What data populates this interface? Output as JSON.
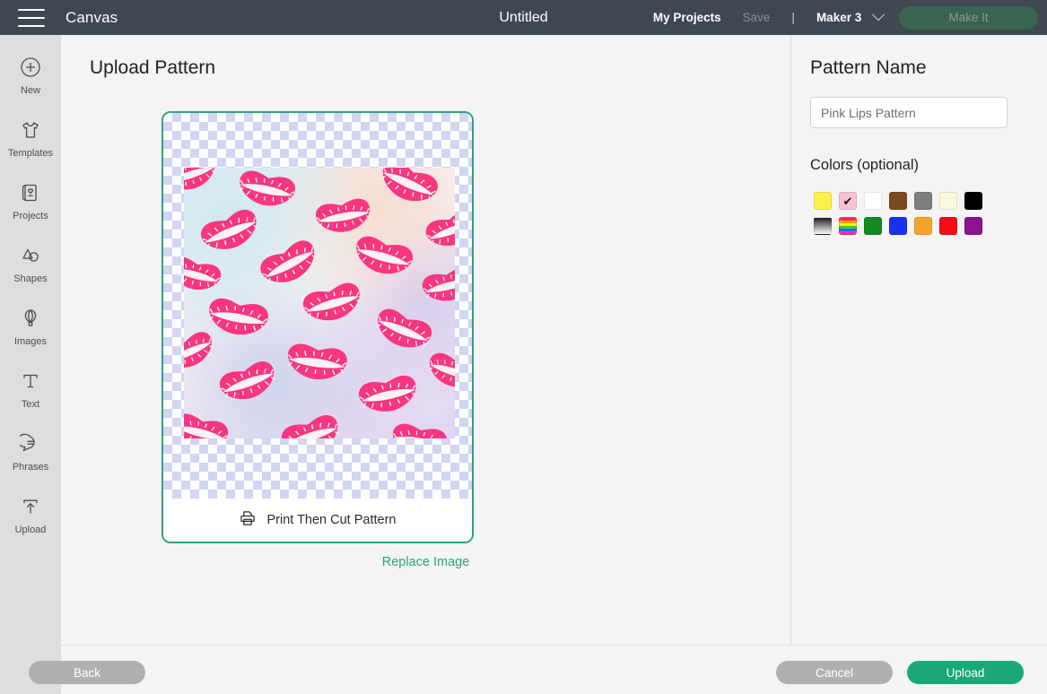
{
  "header": {
    "menu_icon": "hamburger-icon",
    "app_name": "Canvas",
    "project_title": "Untitled",
    "my_projects": "My Projects",
    "save": "Save",
    "separator": "|",
    "machine": "Maker 3",
    "machine_chevron": "chevron-down-icon",
    "make_it": "Make It",
    "bar_color": "#3f4750",
    "make_it_color": "#3a6352"
  },
  "sidebar": {
    "items": [
      {
        "label": "New",
        "icon": "plus-circle-icon"
      },
      {
        "label": "Templates",
        "icon": "tshirt-icon"
      },
      {
        "label": "Projects",
        "icon": "card-heart-icon"
      },
      {
        "label": "Shapes",
        "icon": "shapes-icon"
      },
      {
        "label": "Images",
        "icon": "hot-air-balloon-icon"
      },
      {
        "label": "Text",
        "icon": "text-t-icon"
      },
      {
        "label": "Phrases",
        "icon": "speech-bubble-icon"
      },
      {
        "label": "Upload",
        "icon": "upload-arrow-icon"
      }
    ]
  },
  "main": {
    "page_title": "Upload Pattern",
    "print_then_cut": "Print Then Cut Pattern",
    "print_icon": "printer-icon",
    "replace_image": "Replace Image",
    "card_border_color": "#2ea37c",
    "link_color": "#2ea37c"
  },
  "right_panel": {
    "pattern_name_label": "Pattern Name",
    "pattern_name_value": "Pink Lips Pattern",
    "pattern_name_placeholder": "Pattern Name",
    "colors_label": "Colors (optional)",
    "swatches": [
      {
        "name": "yellow",
        "color": "#fbf14a",
        "selected": false
      },
      {
        "name": "pink",
        "color": "#f9c2d0",
        "selected": true
      },
      {
        "name": "white",
        "color": "#ffffff",
        "selected": false
      },
      {
        "name": "brown",
        "color": "#7a4a25",
        "selected": false
      },
      {
        "name": "gray",
        "color": "#7d7d7d",
        "selected": false
      },
      {
        "name": "cream",
        "color": "#fbf8dc",
        "selected": false
      },
      {
        "name": "black",
        "color": "#000000",
        "selected": false
      },
      {
        "name": "gradient",
        "color": "linear-gradient(#1b1b1b, #ffffff)",
        "selected": false
      },
      {
        "name": "rainbow",
        "color": "rainbow",
        "selected": false
      },
      {
        "name": "green",
        "color": "#138a1f",
        "selected": false
      },
      {
        "name": "blue",
        "color": "#1731f0",
        "selected": false
      },
      {
        "name": "orange",
        "color": "#f5a42b",
        "selected": false
      },
      {
        "name": "red",
        "color": "#f40d16",
        "selected": false
      },
      {
        "name": "purple",
        "color": "#8a138e",
        "selected": false
      }
    ]
  },
  "footer": {
    "back": "Back",
    "cancel": "Cancel",
    "upload": "Upload",
    "upload_color": "#1aa874",
    "disabled_color": "#b0b0b0"
  }
}
